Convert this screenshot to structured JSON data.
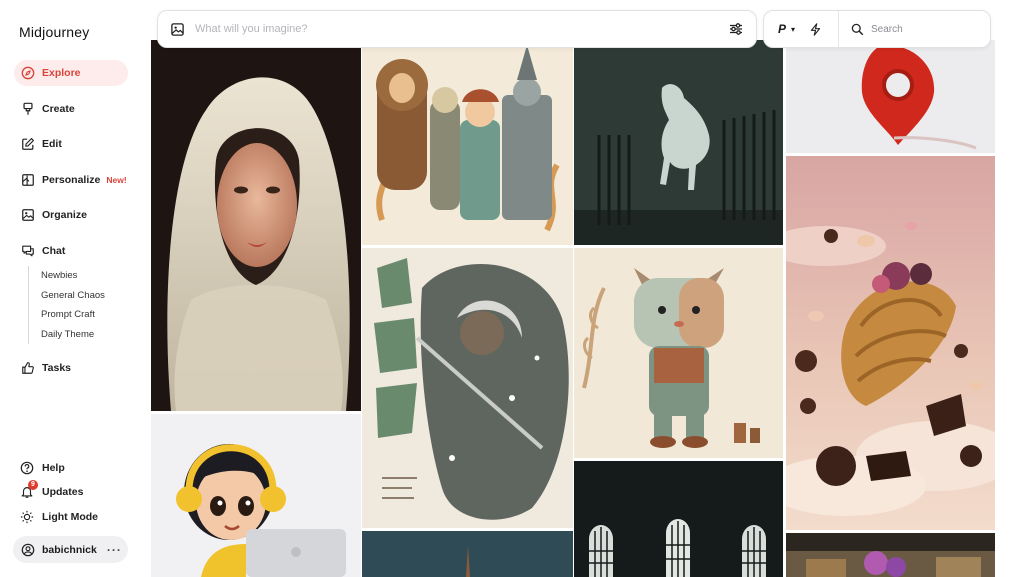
{
  "app": {
    "brand": "Midjourney"
  },
  "sidebar": {
    "items": [
      {
        "label": "Explore",
        "icon": "compass-icon",
        "active": true
      },
      {
        "label": "Create",
        "icon": "brush-icon"
      },
      {
        "label": "Edit",
        "icon": "edit-icon"
      },
      {
        "label": "Personalize",
        "icon": "personalize-icon",
        "badge": "New!"
      },
      {
        "label": "Organize",
        "icon": "image-icon"
      },
      {
        "label": "Chat",
        "icon": "chat-icon"
      }
    ],
    "chat_channels": [
      "Newbies",
      "General Chaos",
      "Prompt Craft",
      "Daily Theme"
    ],
    "tasks": {
      "label": "Tasks",
      "icon": "thumbs-up-icon"
    },
    "bottom": [
      {
        "label": "Help",
        "icon": "help-icon"
      },
      {
        "label": "Updates",
        "icon": "bell-icon",
        "count": "9"
      },
      {
        "label": "Light Mode",
        "icon": "sun-icon"
      }
    ],
    "user": {
      "name": "babichnick",
      "more": "···"
    }
  },
  "prompt": {
    "placeholder": "What will you imagine?",
    "value": ""
  },
  "tools": {
    "personalize_label": "P",
    "search_placeholder": "Search"
  },
  "colors": {
    "accent": "#d9443b",
    "accent_bg": "#fdeceb"
  },
  "gallery": {
    "tiles": [
      "portrait-in-lace-veil",
      "wizard-of-oz-illustration",
      "white-horse-night",
      "red-location-pin",
      "cartoon-girl-headphones-laptop",
      "samurai-ink-poster",
      "patchwork-cat-doll",
      "flying-croissant-dessert",
      "arched-windows-dark",
      "teal-sky-spire",
      "storefront-street-scene"
    ]
  }
}
